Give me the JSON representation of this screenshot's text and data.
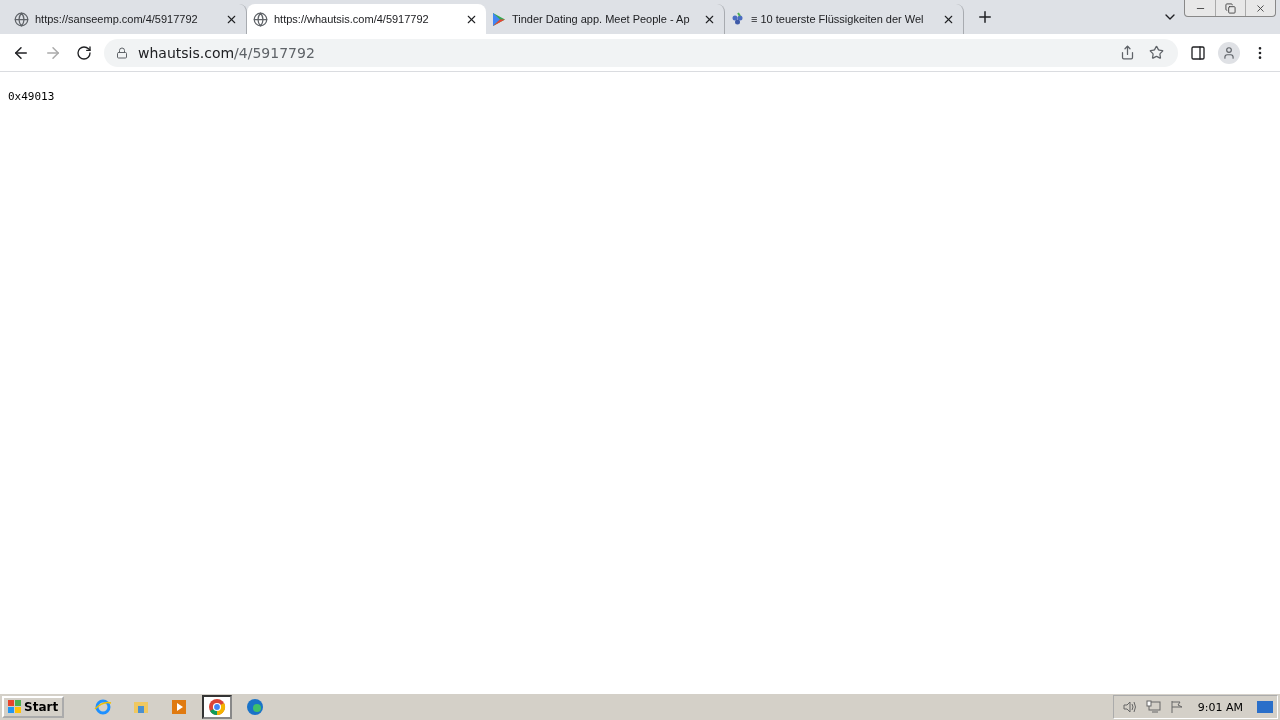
{
  "tabs": [
    {
      "title": "https://sanseemp.com/4/5917792",
      "kind": "globe",
      "selected": false
    },
    {
      "title": "https://whautsis.com/4/5917792",
      "kind": "globe",
      "selected": true
    },
    {
      "title": "Tinder Dating app. Meet People - Ap",
      "kind": "play",
      "selected": false
    },
    {
      "title": "≡ 10 teuerste Flüssigkeiten der Wel",
      "kind": "grape",
      "selected": false
    }
  ],
  "address_bar": {
    "host": "whautsis.com",
    "path": "/4/5917792"
  },
  "page": {
    "text": "0x49013"
  },
  "taskbar": {
    "start": "Start",
    "apps": [
      {
        "kind": "ie",
        "selected": false
      },
      {
        "kind": "explorer",
        "selected": false
      },
      {
        "kind": "media",
        "selected": false
      },
      {
        "kind": "chrome",
        "selected": true
      },
      {
        "kind": "edge",
        "selected": false
      }
    ],
    "clock": "9:01 AM"
  }
}
